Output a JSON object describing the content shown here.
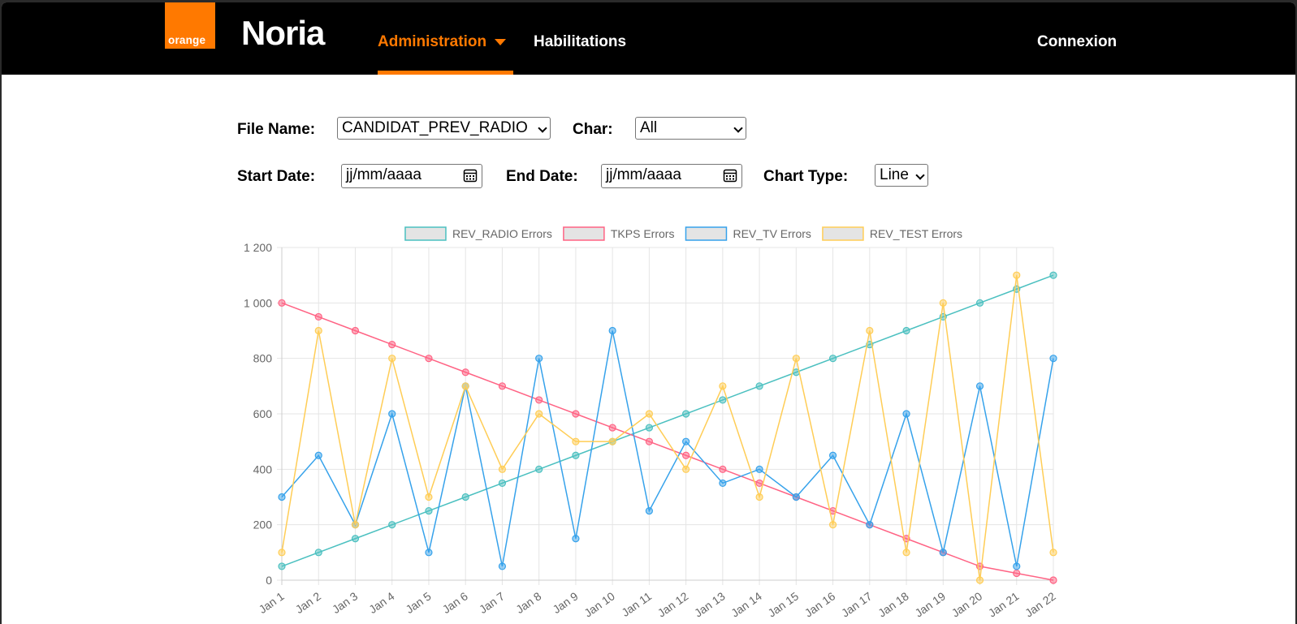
{
  "brand": {
    "logo_text": "orange",
    "app_name": "Noria"
  },
  "nav": {
    "administration": "Administration",
    "habilitations": "Habilitations",
    "connexion": "Connexion"
  },
  "filters": {
    "file_name_label": "File Name:",
    "file_name_value": "CANDIDAT_PREV_RADIO",
    "char_label": "Char:",
    "char_value": "All",
    "start_date_label": "Start Date:",
    "start_date_placeholder": "jj/mm/aaaa",
    "end_date_label": "End Date:",
    "end_date_placeholder": "jj/mm/aaaa",
    "chart_type_label": "Chart Type:",
    "chart_type_value": "Line"
  },
  "chart_data": {
    "type": "line",
    "categories": [
      "Jan 1",
      "Jan 2",
      "Jan 3",
      "Jan 4",
      "Jan 5",
      "Jan 6",
      "Jan 7",
      "Jan 8",
      "Jan 9",
      "Jan 10",
      "Jan 11",
      "Jan 12",
      "Jan 13",
      "Jan 14",
      "Jan 15",
      "Jan 16",
      "Jan 17",
      "Jan 18",
      "Jan 19",
      "Jan 20",
      "Jan 21",
      "Jan 22"
    ],
    "ylim": [
      0,
      1200
    ],
    "yticks": [
      0,
      200,
      400,
      600,
      800,
      1000,
      1200
    ],
    "ytick_labels": [
      "0",
      "200",
      "400",
      "600",
      "800",
      "1 000",
      "1 200"
    ],
    "grid": true,
    "legend_position": "top",
    "series": [
      {
        "name": "REV_RADIO Errors",
        "color": "#4bc0c0",
        "values": [
          50,
          100,
          150,
          200,
          250,
          300,
          350,
          400,
          450,
          500,
          550,
          600,
          650,
          700,
          750,
          800,
          850,
          900,
          950,
          1000,
          1050,
          1100
        ]
      },
      {
        "name": "TKPS Errors",
        "color": "#ff6384",
        "values": [
          1000,
          950,
          900,
          850,
          800,
          750,
          700,
          650,
          600,
          550,
          500,
          450,
          400,
          350,
          300,
          250,
          200,
          150,
          100,
          50,
          25,
          0
        ]
      },
      {
        "name": "REV_TV Errors",
        "color": "#36a2eb",
        "values": [
          300,
          450,
          200,
          600,
          100,
          700,
          50,
          800,
          150,
          900,
          250,
          500,
          350,
          400,
          300,
          450,
          200,
          600,
          100,
          700,
          50,
          800
        ]
      },
      {
        "name": "REV_TEST Errors",
        "color": "#ffcd56",
        "values": [
          100,
          900,
          200,
          800,
          300,
          700,
          400,
          600,
          500,
          500,
          600,
          400,
          700,
          300,
          800,
          200,
          900,
          100,
          1000,
          0,
          1100,
          100
        ]
      }
    ]
  }
}
